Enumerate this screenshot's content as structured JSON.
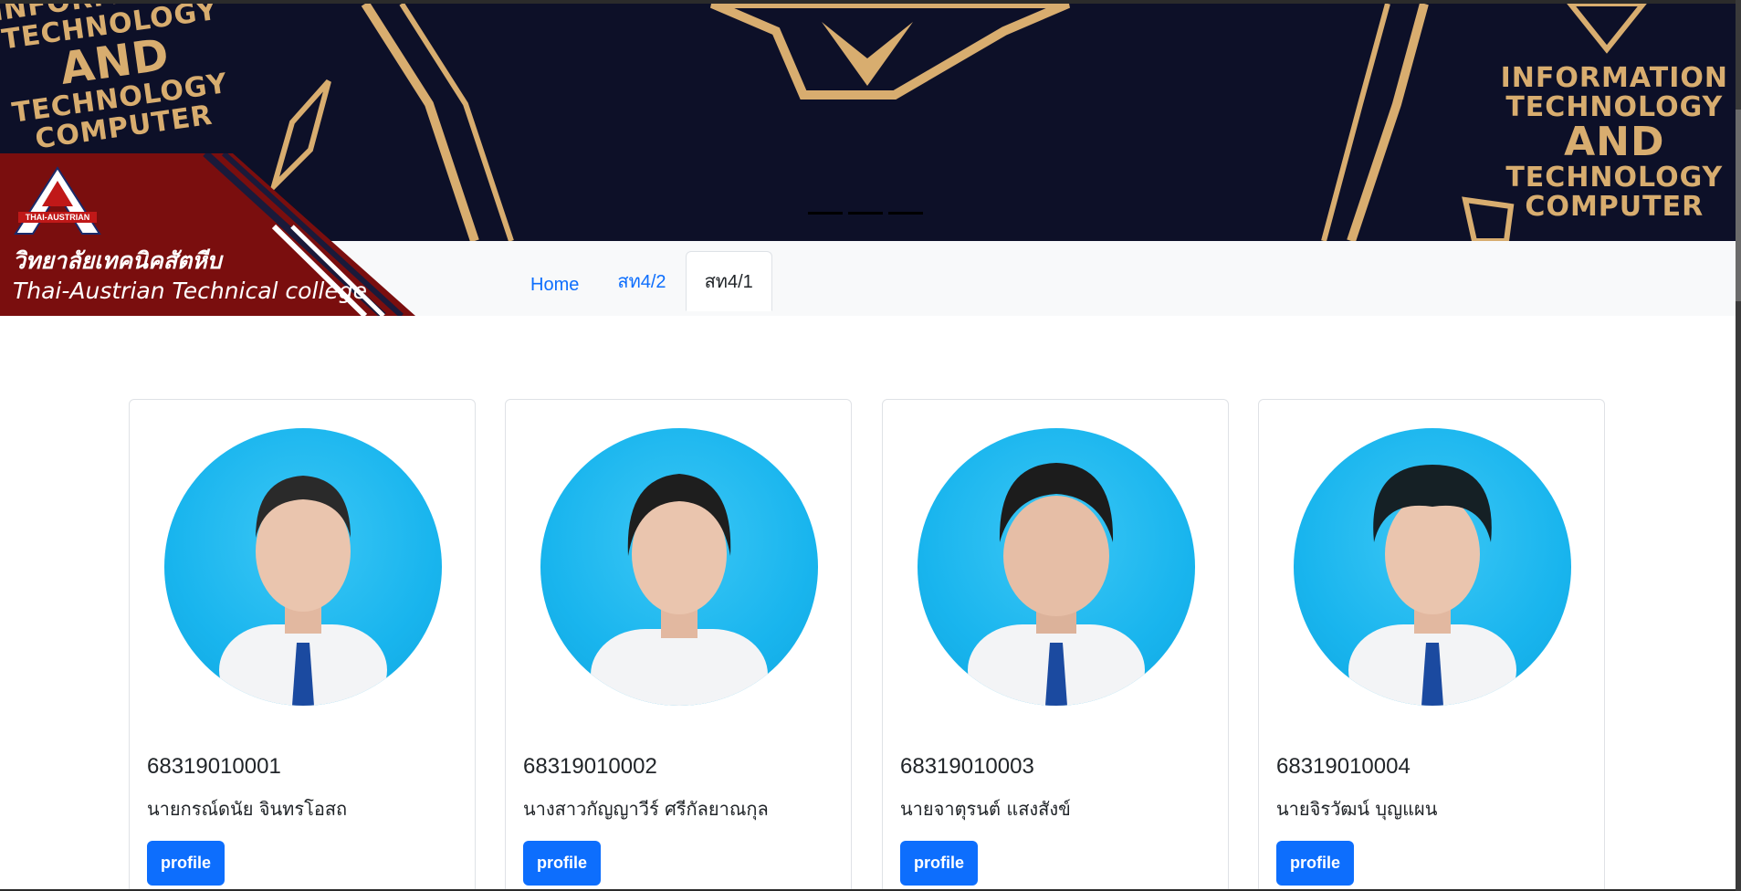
{
  "brand": {
    "logo_text": "THAI-AUSTRIAN",
    "name_th": "วิทยาลัยเทคนิคสัตหีบ",
    "name_en": "Thai-Austrian Technical college",
    "color": "#7a0e0e"
  },
  "hero": {
    "left_lines": [
      "INFORMATION",
      "TECHNOLOGY",
      "AND",
      "TECHNOLOGY",
      "COMPUTER"
    ],
    "right_lines": [
      "INFORMATION",
      "TECHNOLOGY",
      "AND",
      "TECHNOLOGY",
      "COMPUTER"
    ],
    "background": "#0d1028",
    "accent": "#d8ad6f",
    "slide_count": 3
  },
  "nav": {
    "tabs": [
      {
        "label": "Home",
        "active": false
      },
      {
        "label": "สท4/2",
        "active": false
      },
      {
        "label": "สท4/1",
        "active": true
      }
    ]
  },
  "students": [
    {
      "id": "68319010001",
      "name": "นายกรณ์ดนัย จินทรโอสถ",
      "button": "profile"
    },
    {
      "id": "68319010002",
      "name": "นางสาวกัญญาวีร์ ศรีกัลยาณกุล",
      "button": "profile"
    },
    {
      "id": "68319010003",
      "name": "นายจาตุรนต์ แสงสังข์",
      "button": "profile"
    },
    {
      "id": "68319010004",
      "name": "นายจิรวัฒน์ บุญแผน",
      "button": "profile"
    }
  ],
  "colors": {
    "primary": "#0d6efd",
    "navbar_bg": "#f8f9fa",
    "avatar_bg": "#19b5ee"
  }
}
